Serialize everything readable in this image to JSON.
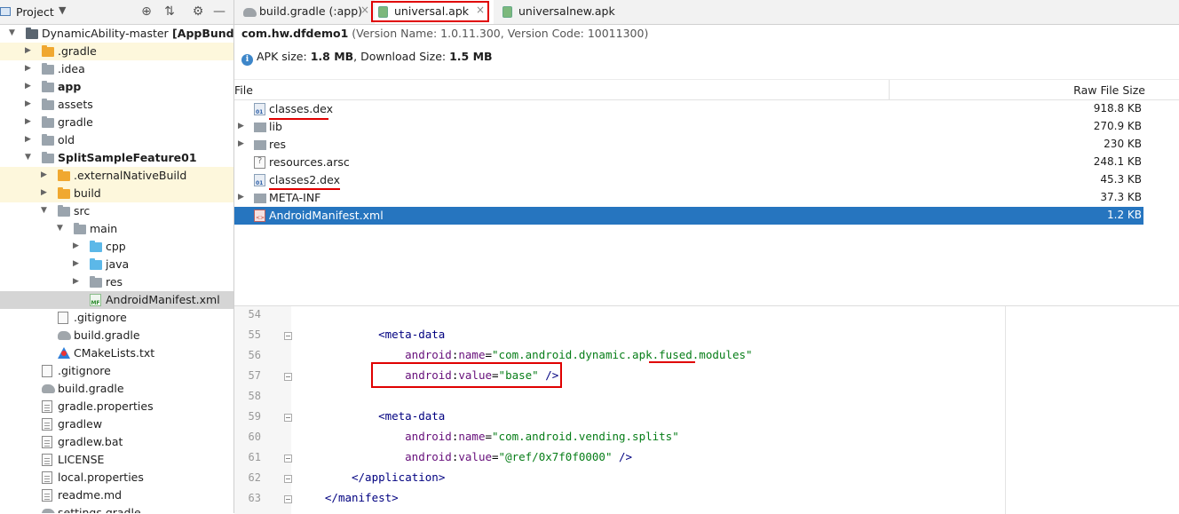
{
  "project": {
    "title": "Project",
    "tree": [
      {
        "label": "DynamicAbility-master",
        "suffix": "[AppBundleDem",
        "level": 0,
        "arrow": "▼",
        "icon": "folder-dark",
        "style": "root"
      },
      {
        "label": ".gradle",
        "level": 1,
        "arrow": "▶",
        "icon": "folder-orange",
        "style": "hl"
      },
      {
        "label": ".idea",
        "level": 1,
        "arrow": "▶",
        "icon": "folder-gray"
      },
      {
        "label": "app",
        "level": 1,
        "arrow": "▶",
        "icon": "folder-module",
        "style": "bold"
      },
      {
        "label": "assets",
        "level": 1,
        "arrow": "▶",
        "icon": "folder-gray"
      },
      {
        "label": "gradle",
        "level": 1,
        "arrow": "▶",
        "icon": "folder-gray"
      },
      {
        "label": "old",
        "level": 1,
        "arrow": "▶",
        "icon": "folder-gray"
      },
      {
        "label": "SplitSampleFeature01",
        "level": 1,
        "arrow": "▼",
        "icon": "folder-module",
        "style": "bold"
      },
      {
        "label": ".externalNativeBuild",
        "level": 2,
        "arrow": "▶",
        "icon": "folder-orange",
        "style": "hl"
      },
      {
        "label": "build",
        "level": 2,
        "arrow": "▶",
        "icon": "folder-orange",
        "style": "hl"
      },
      {
        "label": "src",
        "level": 2,
        "arrow": "▼",
        "icon": "folder-gray"
      },
      {
        "label": "main",
        "level": 3,
        "arrow": "▼",
        "icon": "folder-gray"
      },
      {
        "label": "cpp",
        "level": 4,
        "arrow": "▶",
        "icon": "folder-cyan"
      },
      {
        "label": "java",
        "level": 4,
        "arrow": "▶",
        "icon": "folder-cyan"
      },
      {
        "label": "res",
        "level": 4,
        "arrow": "▶",
        "icon": "folder-gray"
      },
      {
        "label": "AndroidManifest.xml",
        "level": 4,
        "arrow": "",
        "icon": "manifest",
        "style": "sel"
      },
      {
        "label": ".gitignore",
        "level": 2,
        "arrow": "",
        "icon": "file"
      },
      {
        "label": "build.gradle",
        "level": 2,
        "arrow": "",
        "icon": "gradle"
      },
      {
        "label": "CMakeLists.txt",
        "level": 2,
        "arrow": "",
        "icon": "cmake"
      },
      {
        "label": ".gitignore",
        "level": 1,
        "arrow": "",
        "icon": "file"
      },
      {
        "label": "build.gradle",
        "level": 1,
        "arrow": "",
        "icon": "gradle"
      },
      {
        "label": "gradle.properties",
        "level": 1,
        "arrow": "",
        "icon": "file-lines"
      },
      {
        "label": "gradlew",
        "level": 1,
        "arrow": "",
        "icon": "file-lines"
      },
      {
        "label": "gradlew.bat",
        "level": 1,
        "arrow": "",
        "icon": "file-lines"
      },
      {
        "label": "LICENSE",
        "level": 1,
        "arrow": "",
        "icon": "file-lines"
      },
      {
        "label": "local.properties",
        "level": 1,
        "arrow": "",
        "icon": "file-lines"
      },
      {
        "label": "readme.md",
        "level": 1,
        "arrow": "",
        "icon": "file-lines"
      },
      {
        "label": "settings.gradle",
        "level": 1,
        "arrow": "",
        "icon": "gradle"
      }
    ]
  },
  "tabs": [
    {
      "label": "build.gradle (:app)",
      "icon": "gradle",
      "active": false
    },
    {
      "label": "universal.apk",
      "icon": "apk",
      "active": true
    },
    {
      "label": "universalnew.apk",
      "icon": "apk",
      "active": false
    }
  ],
  "apk": {
    "package": "com.hw.dfdemo1",
    "version_info": "(Version Name: 1.0.11.300, Version Code: 10011300)",
    "size_label": "APK size:",
    "size_value": "1.8 MB",
    "download_label": ", Download Size:",
    "download_value": "1.5 MB",
    "col_file": "File",
    "col_size": "Raw File Size",
    "files": [
      {
        "name": "classes.dex",
        "size": "918.8 KB",
        "icon": "dex",
        "expandable": false,
        "selected": false
      },
      {
        "name": "lib",
        "size": "270.9 KB",
        "icon": "folder",
        "expandable": true,
        "selected": false
      },
      {
        "name": "res",
        "size": "230 KB",
        "icon": "res",
        "expandable": true,
        "selected": false
      },
      {
        "name": "resources.arsc",
        "size": "248.1 KB",
        "icon": "arsc",
        "expandable": false,
        "selected": false
      },
      {
        "name": "classes2.dex",
        "size": "45.3 KB",
        "icon": "dex",
        "expandable": false,
        "selected": false
      },
      {
        "name": "META-INF",
        "size": "37.3 KB",
        "icon": "folder",
        "expandable": true,
        "selected": false
      },
      {
        "name": "AndroidManifest.xml",
        "size": "1.2 KB",
        "icon": "xml",
        "expandable": false,
        "selected": true
      }
    ]
  },
  "editor": {
    "lines": [
      {
        "n": "54",
        "parts": []
      },
      {
        "n": "55",
        "indent": 4,
        "fold": true,
        "parts": [
          [
            "tag",
            "<meta-data"
          ]
        ]
      },
      {
        "n": "56",
        "indent": 8,
        "parts": [
          [
            "attr",
            "android"
          ],
          [
            "txt",
            ":"
          ],
          [
            "attr",
            "name"
          ],
          [
            "txt",
            "="
          ],
          [
            "str",
            "\"com.android.dynamic.apk.fused.modules\""
          ]
        ]
      },
      {
        "n": "57",
        "indent": 8,
        "fold": true,
        "parts": [
          [
            "attr",
            "android"
          ],
          [
            "txt",
            ":"
          ],
          [
            "attr",
            "value"
          ],
          [
            "txt",
            "="
          ],
          [
            "str",
            "\"base\""
          ],
          [
            "txt",
            " "
          ],
          [
            "tag",
            "/>"
          ]
        ]
      },
      {
        "n": "58",
        "parts": []
      },
      {
        "n": "59",
        "indent": 4,
        "fold": true,
        "parts": [
          [
            "tag",
            "<meta-data"
          ]
        ]
      },
      {
        "n": "60",
        "indent": 8,
        "parts": [
          [
            "attr",
            "android"
          ],
          [
            "txt",
            ":"
          ],
          [
            "attr",
            "name"
          ],
          [
            "txt",
            "="
          ],
          [
            "str",
            "\"com.android.vending.splits\""
          ]
        ]
      },
      {
        "n": "61",
        "indent": 8,
        "fold": true,
        "parts": [
          [
            "attr",
            "android"
          ],
          [
            "txt",
            ":"
          ],
          [
            "attr",
            "value"
          ],
          [
            "txt",
            "="
          ],
          [
            "str",
            "\"@ref/0x7f0f0000\""
          ],
          [
            "txt",
            " "
          ],
          [
            "tag",
            "/>"
          ]
        ]
      },
      {
        "n": "62",
        "indent": 0,
        "fold": true,
        "parts": [
          [
            "tag",
            "</application>"
          ]
        ]
      },
      {
        "n": "63",
        "indent": -4,
        "fold": true,
        "parts": [
          [
            "tag",
            "</manifest>"
          ]
        ]
      }
    ]
  },
  "colors": {
    "selection": "#2675bf",
    "highlight_box": "#e00000",
    "tag": "#000080",
    "attr": "#660e7a",
    "string": "#067d17"
  }
}
